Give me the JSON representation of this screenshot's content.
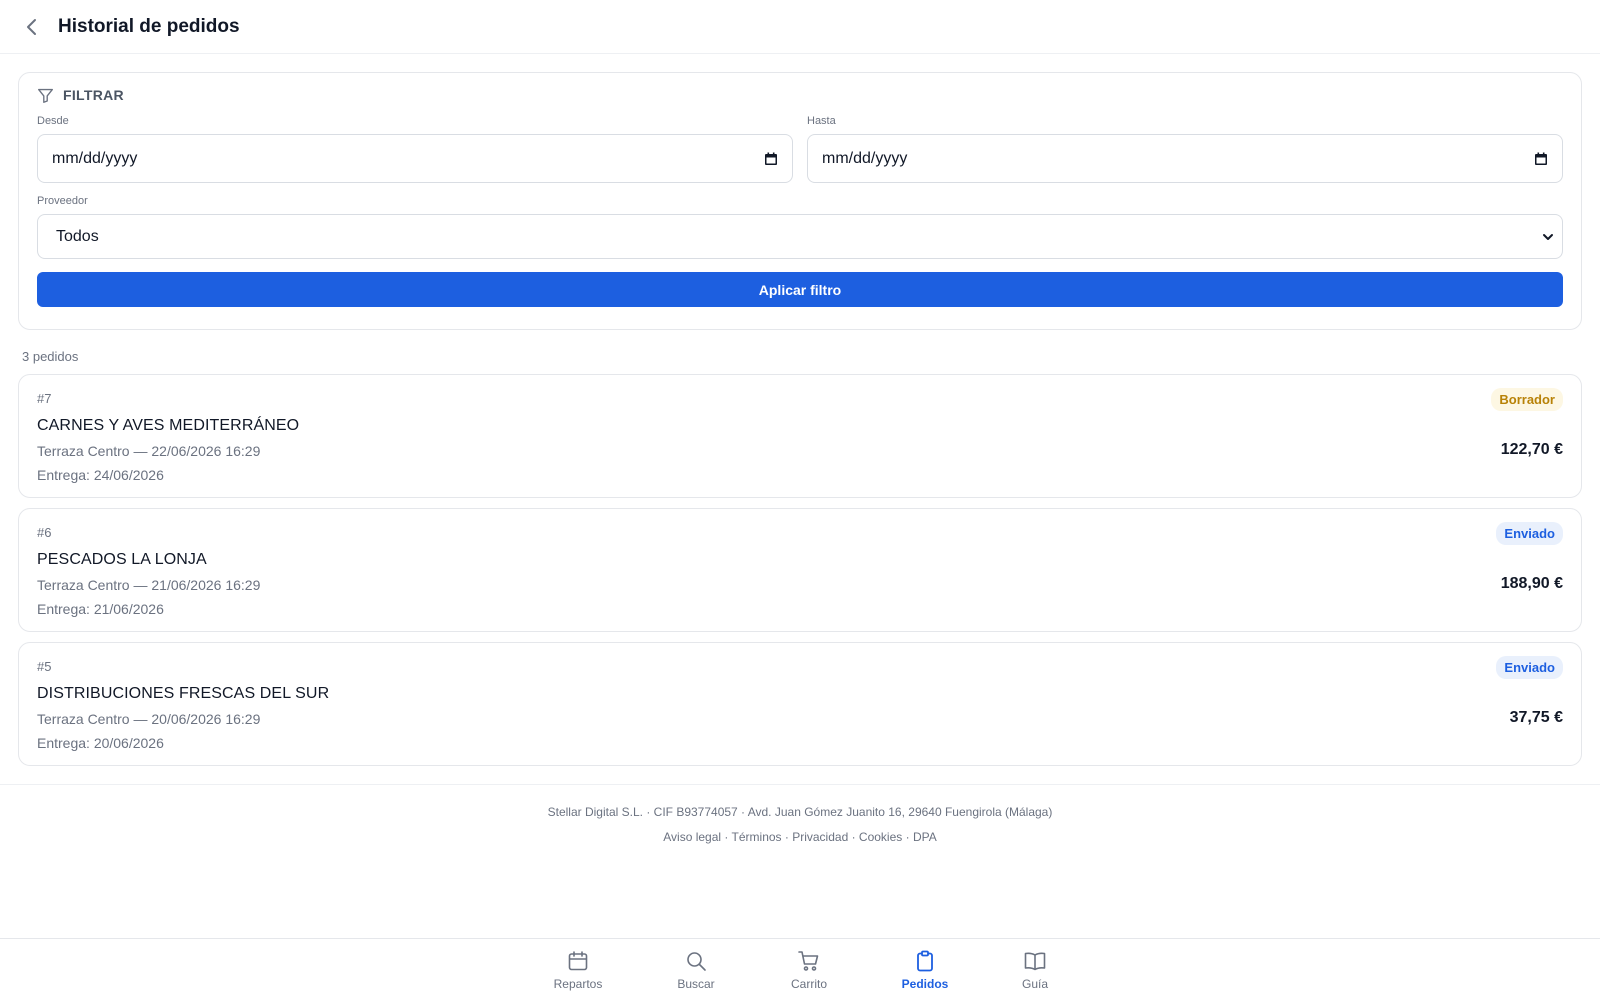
{
  "header": {
    "title": "Historial de pedidos",
    "back_icon": "chevron-left-icon"
  },
  "filter": {
    "heading": "FILTRAR",
    "icon": "filter-icon",
    "from_label": "Desde",
    "from_value": "mm/dd/yyyy",
    "to_label": "Hasta",
    "to_value": "mm/dd/yyyy",
    "supplier_label": "Proveedor",
    "supplier_value": "Todos",
    "apply_label": "Aplicar filtro"
  },
  "orders_count": "3 pedidos",
  "orders": [
    {
      "id": "#7",
      "supplier": "CARNES Y AVES MEDITERRÁNEO",
      "meta": "Terraza Centro — 22/06/2026 16:29",
      "delivery": "Entrega: 24/06/2026",
      "status": "Borrador",
      "amount": "122,70 €"
    },
    {
      "id": "#6",
      "supplier": "PESCADOS LA LONJA",
      "meta": "Terraza Centro — 21/06/2026 16:29",
      "delivery": "Entrega: 21/06/2026",
      "status": "Enviado",
      "amount": "188,90 €"
    },
    {
      "id": "#5",
      "supplier": "DISTRIBUCIONES FRESCAS DEL SUR",
      "meta": "Terraza Centro — 20/06/2026 16:29",
      "delivery": "Entrega: 20/06/2026",
      "status": "Enviado",
      "amount": "37,75 €"
    }
  ],
  "footer": {
    "company": "Stellar Digital S.L. · CIF B93774057 · Avd. Juan Gómez Juanito 16, 29640 Fuengirola (Málaga)",
    "links": [
      "Aviso legal",
      "Términos",
      "Privacidad",
      "Cookies",
      "DPA"
    ],
    "separator": " · "
  },
  "nav": {
    "items": [
      {
        "label": "Repartos",
        "icon": "calendar-icon"
      },
      {
        "label": "Buscar",
        "icon": "search-icon"
      },
      {
        "label": "Carrito",
        "icon": "cart-icon"
      },
      {
        "label": "Pedidos",
        "icon": "clipboard-icon",
        "active": true
      },
      {
        "label": "Guía",
        "icon": "book-icon"
      }
    ]
  },
  "colors": {
    "accent": "#1d5fe0",
    "draft_text": "#b88207",
    "draft_bg": "#fdf7e3",
    "sent_bg": "#e9f0fc"
  }
}
